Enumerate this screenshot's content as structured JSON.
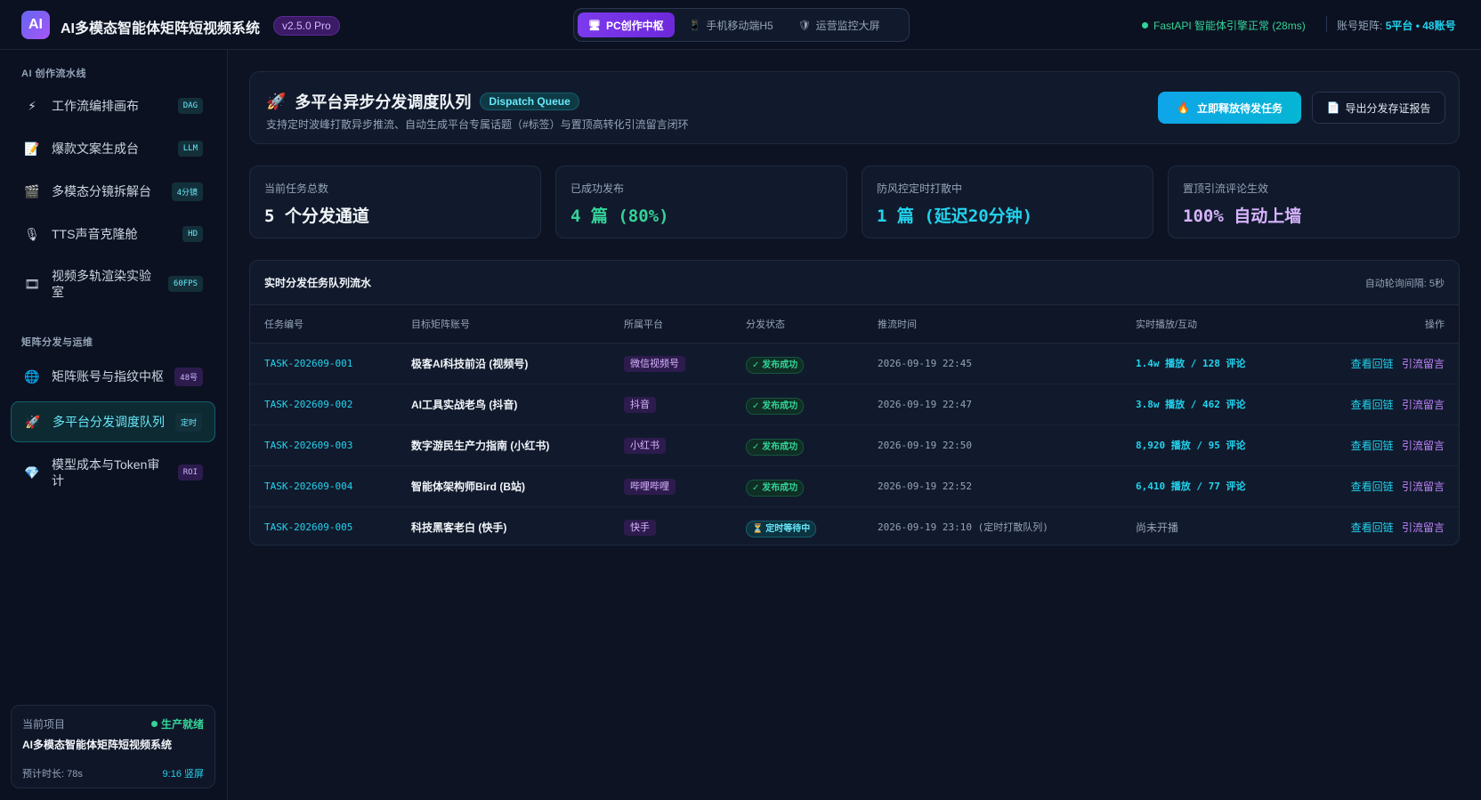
{
  "header": {
    "logo": "AI",
    "title": "AI多模态智能体矩阵短视频系统",
    "version": "v2.5.0 Pro",
    "modes": [
      {
        "label": "PC创作中枢",
        "icon": "monitor-icon",
        "active": true
      },
      {
        "label": "手机移动端H5",
        "icon": "phone-icon",
        "active": false
      },
      {
        "label": "运营监控大屏",
        "icon": "shield-icon",
        "active": false
      }
    ],
    "engine_status": "FastAPI 智能体引擎正常 (28ms)",
    "matrix_label": "账号矩阵:",
    "matrix_value": "5平台 • 48账号"
  },
  "sidebar": {
    "section1": "AI 创作流水线",
    "section2": "矩阵分发与运维",
    "items": [
      {
        "label": "工作流编排画布",
        "tag": "DAG",
        "icon": "lightning-icon",
        "glyph": "⚡"
      },
      {
        "label": "爆款文案生成台",
        "tag": "LLM",
        "icon": "document-icon",
        "glyph": "📝"
      },
      {
        "label": "多模态分镜拆解台",
        "tag": "4分镜",
        "icon": "clapper-icon",
        "glyph": "🎬"
      },
      {
        "label": "TTS声音克隆舱",
        "tag": "HD",
        "icon": "microphone-icon",
        "glyph": "🎙"
      },
      {
        "label": "视频多轨渲染实验室",
        "tag": "60FPS",
        "icon": "film-icon",
        "glyph": "🎞"
      },
      {
        "label": "矩阵账号与指纹中枢",
        "tag": "48号",
        "icon": "globe-icon",
        "glyph": "🌐"
      },
      {
        "label": "多平台分发调度队列",
        "tag": "定时",
        "icon": "rocket-icon",
        "glyph": "🚀"
      },
      {
        "label": "模型成本与Token审计",
        "tag": "ROI",
        "icon": "diamond-icon",
        "glyph": "💎"
      }
    ],
    "project": {
      "label": "当前项目",
      "status": "生产就绪",
      "name": "AI多模态智能体矩阵短视频系统",
      "duration": "预计时长: 78s",
      "ratio": "9:16 竖屏"
    }
  },
  "hero": {
    "title": "多平台异步分发调度队列",
    "badge": "Dispatch Queue",
    "subtitle": "支持定时波峰打散异步推流、自动生成平台专属话题（#标签）与置顶高转化引流留言闭环",
    "primary_button": "立即释放待发任务",
    "secondary_button": "导出分发存证报告"
  },
  "stats": [
    {
      "label": "当前任务总数",
      "value": "5 个分发通道",
      "color": "#f1f5f9"
    },
    {
      "label": "已成功发布",
      "value": "4 篇 (80%)",
      "color": "#34d399"
    },
    {
      "label": "防风控定时打散中",
      "value": "1 篇 (延迟20分钟)",
      "color": "#22d3ee"
    },
    {
      "label": "置顶引流评论生效",
      "value": "100% 自动上墙",
      "color": "#d8b4fe"
    }
  ],
  "queue": {
    "title": "实时分发任务队列流水",
    "poll": "自动轮询间隔: 5秒",
    "columns": [
      "任务编号",
      "目标矩阵账号",
      "所属平台",
      "分发状态",
      "推流时间",
      "实时播放/互动",
      "操作"
    ],
    "rows": [
      {
        "id": "TASK-202609-001",
        "account": "极客AI科技前沿 (视频号)",
        "platform": "微信视频号",
        "status": "✓ 发布成功",
        "status_type": "ok",
        "time": "2026-09-19 22:45",
        "metric": "1.4w 播放 / 128 评论",
        "op1": "查看回链",
        "op2": "引流留言"
      },
      {
        "id": "TASK-202609-002",
        "account": "AI工具实战老鸟 (抖音)",
        "platform": "抖音",
        "status": "✓ 发布成功",
        "status_type": "ok",
        "time": "2026-09-19 22:47",
        "metric": "3.8w 播放 / 462 评论",
        "op1": "查看回链",
        "op2": "引流留言"
      },
      {
        "id": "TASK-202609-003",
        "account": "数字游民生产力指南 (小红书)",
        "platform": "小红书",
        "status": "✓ 发布成功",
        "status_type": "ok",
        "time": "2026-09-19 22:50",
        "metric": "8,920 播放 / 95 评论",
        "op1": "查看回链",
        "op2": "引流留言"
      },
      {
        "id": "TASK-202609-004",
        "account": "智能体架构师Bird (B站)",
        "platform": "哔哩哔哩",
        "status": "✓ 发布成功",
        "status_type": "ok",
        "time": "2026-09-19 22:52",
        "metric": "6,410 播放 / 77 评论",
        "op1": "查看回链",
        "op2": "引流留言"
      },
      {
        "id": "TASK-202609-005",
        "account": "科技黑客老白 (快手)",
        "platform": "快手",
        "status": "⏳ 定时等待中",
        "status_type": "wait",
        "time": "2026-09-19 23:10 (定时打散队列)",
        "metric": "尚未开播",
        "op1": "查看回链",
        "op2": "引流留言"
      }
    ]
  }
}
